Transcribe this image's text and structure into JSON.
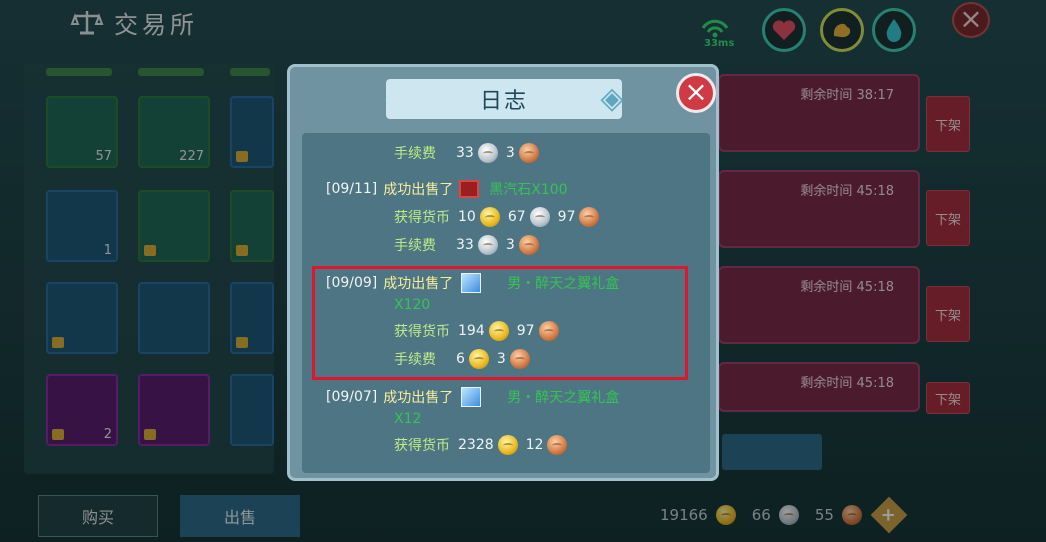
{
  "header": {
    "title": "交易所",
    "ping": "33ms"
  },
  "left_grid": {
    "slots": [
      {
        "count": "57"
      },
      {
        "count": "227"
      },
      {
        "count": ""
      },
      {
        "count": "1"
      },
      {
        "count": ""
      },
      {
        "count": ""
      },
      {
        "count": ""
      },
      {
        "count": ""
      },
      {
        "count": ""
      },
      {
        "count": ""
      },
      {
        "count": ""
      },
      {
        "count": "2"
      }
    ]
  },
  "listings": [
    {
      "time": "剩余时间  38:17",
      "button": "下架"
    },
    {
      "time": "剩余时间  45:18",
      "button": "下架"
    },
    {
      "time": "剩余时间  45:18",
      "button": "下架"
    },
    {
      "time": "剩余时间  45:18",
      "button": "下架"
    }
  ],
  "bottom": {
    "buy": "购买",
    "sell": "出售",
    "gold": "19166",
    "silver": "66",
    "copper": "55",
    "add": "+"
  },
  "modal": {
    "title": "日志",
    "entries": [
      {
        "fee_label": "手续费",
        "fee_silver": "33",
        "fee_copper": "3"
      },
      {
        "date": "[09/11]",
        "action": "成功出售了",
        "item": "黑汽石X100",
        "earn_label": "获得货币",
        "earn_gold": "10",
        "earn_silver": "67",
        "earn_copper": "97",
        "fee_label": "手续费",
        "fee_silver": "33",
        "fee_copper": "3"
      },
      {
        "date": "[09/09]",
        "action": "成功出售了",
        "item": "男・醉天之翼礼盒",
        "item2": "X120",
        "earn_label": "获得货币",
        "earn_gold": "194",
        "earn_copper": "97",
        "fee_label": "手续费",
        "fee_gold": "6",
        "fee_copper": "3"
      },
      {
        "date": "[09/07]",
        "action": "成功出售了",
        "item": "男・醉天之翼礼盒",
        "item2": "X12",
        "earn_label": "获得货币",
        "earn_gold": "2328",
        "earn_copper": "12"
      }
    ]
  }
}
